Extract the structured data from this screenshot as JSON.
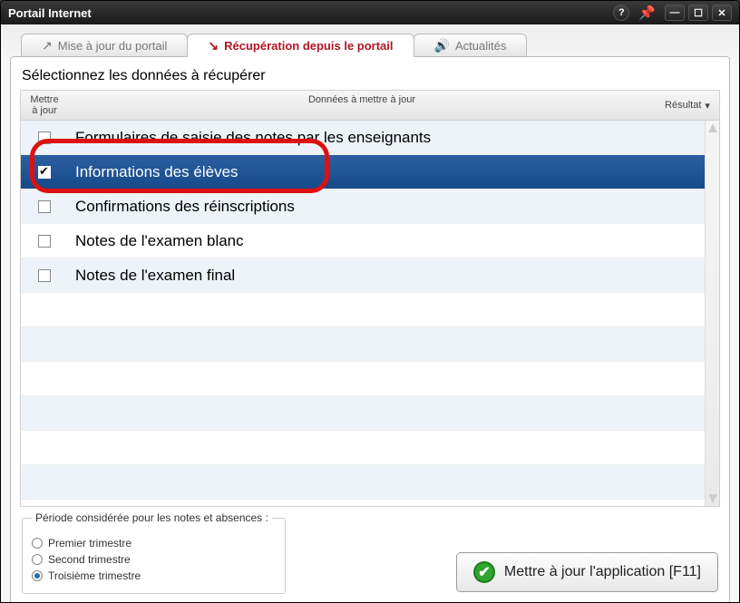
{
  "window": {
    "title": "Portail Internet"
  },
  "tabs": [
    {
      "label": "Mise à jour du portail",
      "icon": "↗",
      "active": false
    },
    {
      "label": "Récupération depuis le portail",
      "icon": "↘",
      "active": true
    },
    {
      "label": "Actualités",
      "icon": "🔊",
      "active": false
    }
  ],
  "instruction": "Sélectionnez les données à récupérer",
  "columns": {
    "update": "Mettre à jour",
    "data": "Données à mettre à jour",
    "result": "Résultat"
  },
  "rows": [
    {
      "checked": false,
      "label": "Formulaires de saisie des notes par les enseignants",
      "selected": false
    },
    {
      "checked": true,
      "label": "Informations des élèves",
      "selected": true
    },
    {
      "checked": false,
      "label": "Confirmations des réinscriptions",
      "selected": false
    },
    {
      "checked": false,
      "label": "Notes de l'examen blanc",
      "selected": false
    },
    {
      "checked": false,
      "label": "Notes de l'examen final",
      "selected": false
    }
  ],
  "period": {
    "legend": "Période considérée pour les notes et absences :",
    "options": [
      {
        "label": "Premier trimestre",
        "on": false
      },
      {
        "label": "Second trimestre",
        "on": false
      },
      {
        "label": "Troisième trimestre",
        "on": true
      }
    ]
  },
  "update_button": "Mettre à jour l'application [F11]"
}
